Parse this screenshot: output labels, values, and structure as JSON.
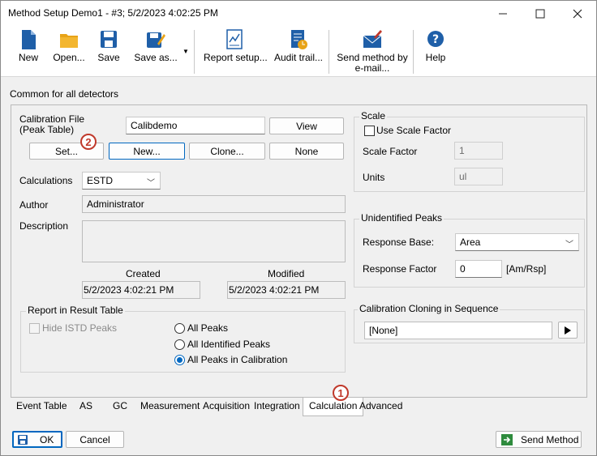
{
  "window": {
    "title": "Method Setup Demo1 - #3;   5/2/2023   4:02:25 PM"
  },
  "toolbar": {
    "new": "New",
    "open": "Open...",
    "save": "Save",
    "save_as": "Save as...",
    "report_setup": "Report setup...",
    "audit_trail": "Audit trail...",
    "send_email_line1": "Send method by",
    "send_email_line2": "e-mail...",
    "help": "Help"
  },
  "section_label": "Common for all detectors",
  "calibration": {
    "label_line1": "Calibration File",
    "label_line2": "(Peak Table)",
    "file_value": "Calibdemo",
    "view_label": "View",
    "set_label": "Set...",
    "new_label": "New...",
    "clone_label": "Clone...",
    "none_label": "None"
  },
  "calculations": {
    "label": "Calculations",
    "value": "ESTD"
  },
  "author": {
    "label": "Author",
    "value": "Administrator"
  },
  "description": {
    "label": "Description",
    "value": ""
  },
  "dates": {
    "created_label": "Created",
    "created_value": "5/2/2023 4:02:21 PM",
    "modified_label": "Modified",
    "modified_value": "5/2/2023 4:02:21 PM"
  },
  "report": {
    "title": "Report in Result Table",
    "hide_istd": "Hide ISTD Peaks",
    "all_peaks": "All Peaks",
    "all_identified": "All Identified Peaks",
    "all_in_calibration": "All Peaks in Calibration",
    "selected": "All Peaks in Calibration"
  },
  "scale": {
    "title": "Scale",
    "use_scale_factor": "Use Scale Factor",
    "scale_factor_label": "Scale Factor",
    "scale_factor_value": "1",
    "units_label": "Units",
    "units_value": "ul"
  },
  "unidentified": {
    "title": "Unidentified Peaks",
    "response_base_label": "Response Base:",
    "response_base_value": "Area",
    "response_factor_label": "Response Factor",
    "response_factor_value": "0",
    "response_factor_unit": "[Am/Rsp]"
  },
  "cloning": {
    "title": "Calibration Cloning in Sequence",
    "value": "[None]"
  },
  "tabs": [
    "Event Table",
    "AS",
    "GC",
    "Measurement",
    "Acquisition",
    "Integration",
    "Calculation",
    "Advanced"
  ],
  "active_tab": "Calculation",
  "badges": [
    "1",
    "2"
  ],
  "footer": {
    "ok": "OK",
    "cancel": "Cancel",
    "send_method": "Send Method"
  },
  "colors": {
    "accent": "#0067c0",
    "badge": "#c0392b",
    "icon_blue": "#1f5fa8",
    "icon_yellow": "#e8a317"
  }
}
